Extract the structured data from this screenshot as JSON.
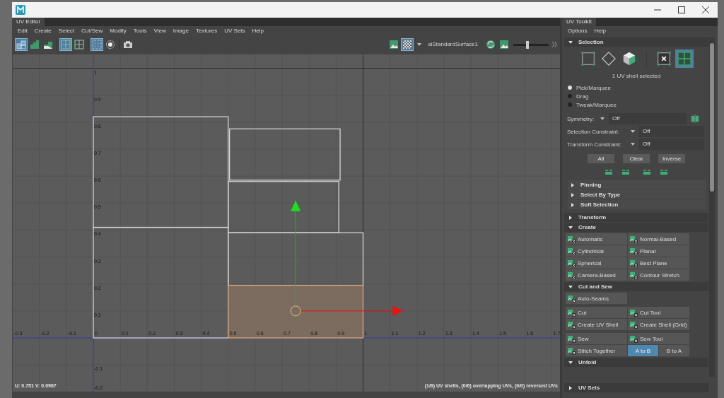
{
  "editor": {
    "tab": "UV Editor",
    "menu": [
      "Edit",
      "Create",
      "Select",
      "Cut/Sew",
      "Modify",
      "Tools",
      "View",
      "Image",
      "Textures",
      "UV Sets",
      "Help"
    ],
    "toolbar_left": [
      [
        {
          "kind": "shell",
          "selected": true
        },
        {
          "kind": "steps",
          "selected": false
        },
        {
          "kind": "steps-shaded",
          "selected": false
        }
      ],
      [
        {
          "kind": "grid",
          "selected": true
        },
        {
          "kind": "grid",
          "selected": false
        }
      ],
      [
        {
          "kind": "dots",
          "selected": true
        },
        {
          "kind": "ring",
          "selected": false
        }
      ],
      [
        {
          "kind": "camera",
          "selected": false
        }
      ]
    ],
    "toolbar_right": [
      {
        "kind": "image",
        "selected": false
      },
      {
        "kind": "checker",
        "selected": true
      }
    ],
    "texture": "aiStandardSurface1",
    "toolbar_extra": [
      {
        "kind": "swap"
      },
      {
        "kind": "image"
      }
    ],
    "exposure": {
      "level": 0.4
    },
    "viewport": {
      "u_ticks": [
        "-0.3",
        "-0.2",
        "-0.1",
        "0",
        "0.1",
        "0.2",
        "0.3",
        "0.4",
        "0.5",
        "0.6",
        "0.7",
        "0.8",
        "0.9",
        "1",
        "1.1",
        "1.2",
        "1.3",
        "1.4",
        "1.5",
        "1.6",
        "1.7"
      ],
      "v_ticks": [
        "1",
        "0.9",
        "0.8",
        "0.7",
        "0.6",
        "0.5",
        "0.4",
        "0.3",
        "0.2",
        "0.1",
        "-0.1",
        "-0.2"
      ],
      "shells": [
        {
          "selected": false
        },
        {
          "selected": false
        },
        {
          "selected": false
        },
        {
          "selected": false
        },
        {
          "selected": false
        },
        {
          "selected": true
        }
      ],
      "coords": "U:  0.751 V:  0.0967",
      "stats": "(1/6) UV shells, (0/6) overlapping UVs, (0/0) reversed UVs"
    }
  },
  "toolkit": {
    "tab": "UV Toolkit",
    "menu": [
      "Options",
      "Help"
    ],
    "selection": {
      "title": "Selection",
      "expanded": true,
      "modes": [
        {
          "kind": "vertex",
          "selected": false
        },
        {
          "kind": "edge",
          "selected": false
        },
        {
          "kind": "face",
          "selected": false
        },
        {
          "kind": "uv",
          "selected": false
        },
        {
          "kind": "shell",
          "selected": true
        }
      ],
      "status": "1 UV shell selected",
      "styles": [
        {
          "label": "Pick/Marquee",
          "selected": true
        },
        {
          "label": "Drag",
          "selected": false
        },
        {
          "label": "Tweak/Marquee",
          "selected": false
        }
      ],
      "symmetry": {
        "label": "Symmetry:",
        "value": "Off"
      },
      "constraints": [
        {
          "label": "Selection Constraint:",
          "value": "Off"
        },
        {
          "label": "Transform Constraint:",
          "value": "Off"
        }
      ],
      "buttons": [
        "All",
        "Clear",
        "Inverse"
      ],
      "subsections": [
        {
          "title": "Pinning",
          "expanded": false
        },
        {
          "title": "Select By Type",
          "expanded": false
        },
        {
          "title": "Soft Selection",
          "expanded": false
        }
      ]
    },
    "sections": [
      {
        "title": "Transform",
        "expanded": false
      },
      {
        "title": "Create",
        "expanded": true,
        "groups": [
          [
            [
              {
                "kind": "tool",
                "label": "Automatic"
              },
              {
                "kind": "tool",
                "label": "Normal-Based"
              }
            ],
            [
              {
                "kind": "tool",
                "label": "Cylindrical"
              },
              {
                "kind": "tool",
                "label": "Planar"
              }
            ],
            [
              {
                "kind": "tool",
                "label": "Spherical"
              },
              {
                "kind": "tool",
                "label": "Best Plane"
              }
            ],
            [
              {
                "kind": "tool",
                "label": "Camera-Based"
              },
              {
                "kind": "tool",
                "label": "Contour Stretch"
              }
            ]
          ]
        ]
      },
      {
        "title": "Cut and Sew",
        "expanded": true,
        "groups": [
          [
            [
              {
                "kind": "tool",
                "label": "Auto-Seams"
              }
            ]
          ],
          [
            [
              {
                "kind": "tool",
                "label": "Cut"
              },
              {
                "kind": "tool",
                "label": "Cut Tool"
              }
            ],
            [
              {
                "kind": "tool",
                "label": "Create UV Shell"
              },
              {
                "kind": "tool",
                "label": "Create Shell (Grid)"
              }
            ]
          ],
          [
            [
              {
                "kind": "tool",
                "label": "Sew"
              },
              {
                "kind": "tool",
                "label": "Sew Tool"
              }
            ],
            [
              {
                "kind": "tool",
                "label": "Stitch Together"
              },
              {
                "kind": "toggle",
                "label": "A to B",
                "selected": true
              },
              {
                "kind": "toggle",
                "label": "B to A",
                "selected": false
              }
            ]
          ]
        ]
      },
      {
        "title": "Unfold",
        "expanded": true
      }
    ],
    "footer": {
      "title": "UV Sets",
      "expanded": false
    }
  }
}
